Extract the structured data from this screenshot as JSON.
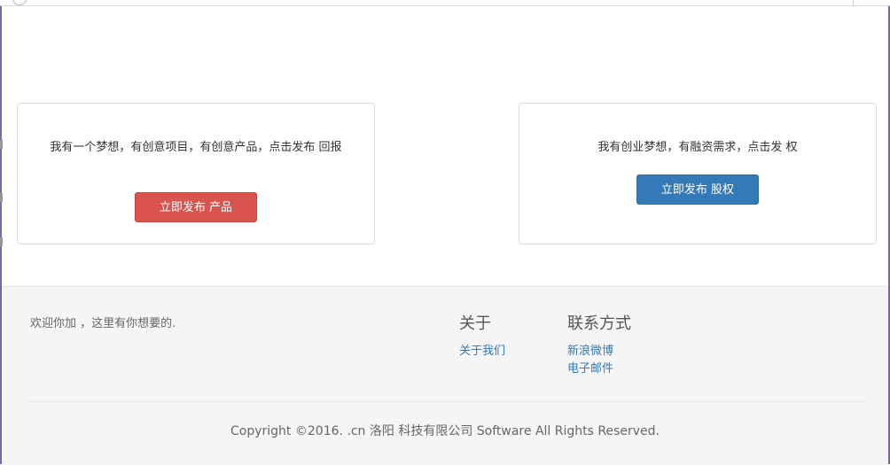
{
  "cards": {
    "left": {
      "text": "我有一个梦想，有创意项目，有创意产品，点击发布 回报",
      "button": "立即发布 产品"
    },
    "right": {
      "text": "我有创业梦想，有融资需求，点击发 权",
      "button": "立即发布 股权"
    }
  },
  "footer": {
    "welcome": "欢迎你加 ，这里有你想要的.",
    "about": {
      "title": "关于",
      "links": [
        "关于我们"
      ]
    },
    "contact": {
      "title": "联系方式",
      "links": [
        "新浪微博",
        "电子邮件"
      ]
    },
    "copyright": "Copyright ©2016. .cn 洛阳 科技有限公司 Software All Rights Reserved."
  },
  "colors": {
    "primary": "#337ab7",
    "danger": "#d9534f",
    "footer_bg": "#f5f5f5"
  }
}
